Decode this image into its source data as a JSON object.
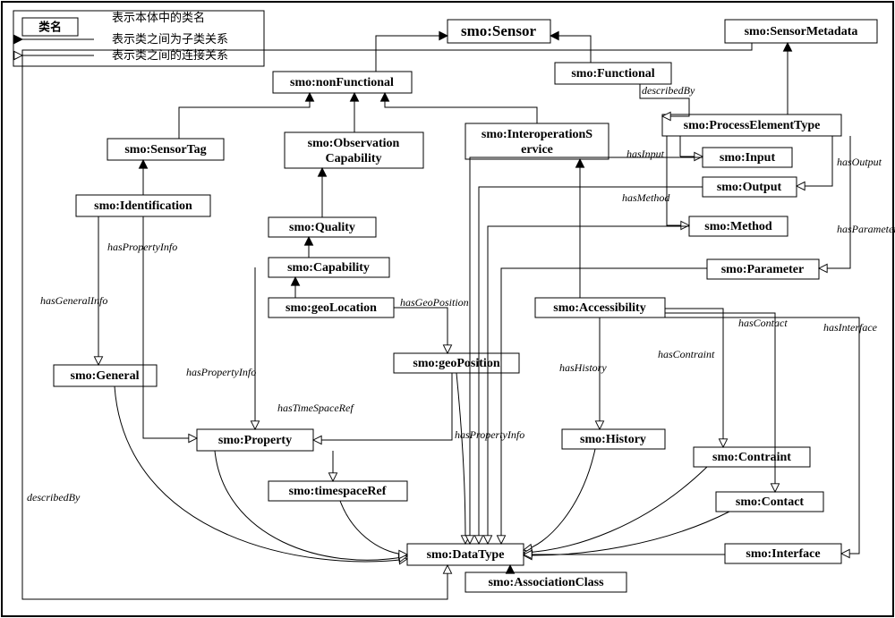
{
  "legend": {
    "title": "类名",
    "desc_class": "表示本体中的类名",
    "desc_sub": "表示类之间为子类关系",
    "desc_link": "表示类之间的连接关系"
  },
  "nodes": {
    "sensor": "smo:Sensor",
    "sensormeta": "smo:SensorMetadata",
    "nonfunc": "smo:nonFunctional",
    "func": "smo:Functional",
    "sensortag": "smo:SensorTag",
    "obscap": "smo:Observation\nCapability",
    "interop": "smo:InteroperationS\nervice",
    "procel": "smo:ProcessElementType",
    "input": "smo:Input",
    "output": "smo:Output",
    "method": "smo:Method",
    "parameter": "smo:Parameter",
    "ident": "smo:Identification",
    "quality": "smo:Quality",
    "capability": "smo:Capability",
    "geoloc": "smo:geoLocation",
    "access": "smo:Accessibility",
    "general": "smo:General",
    "geopos": "smo:geoPosition",
    "property": "smo:Property",
    "tsref": "smo:timespaceRef",
    "history": "smo:History",
    "contraint": "smo:Contraint",
    "contact": "smo:Contact",
    "datatype": "smo:DataType",
    "assoc": "smo:AssociationClass",
    "interface": "smo:Interface"
  },
  "edge_labels": {
    "describedBy1": "describedBy",
    "describedBy2": "describedBy",
    "hasGeneralInfo": "hasGeneralInfo",
    "hasPropertyInfo1": "hasPropertyInfo",
    "hasPropertyInfo2": "hasPropertyInfo",
    "hasPropertyInfo3": "hasPropertyInfo",
    "hasGeoPosition": "hasGeoPosition",
    "hasTimeSpaceRef": "hasTimeSpaceRef",
    "hasHistory": "hasHistory",
    "hasContraint": "hasContraint",
    "hasContact": "hasContact",
    "hasInterface": "hasInterface",
    "hasInput": "hasInput",
    "hasMethod": "hasMethod",
    "hasOutput": "hasOutput",
    "hasParameter": "hasParameter"
  }
}
